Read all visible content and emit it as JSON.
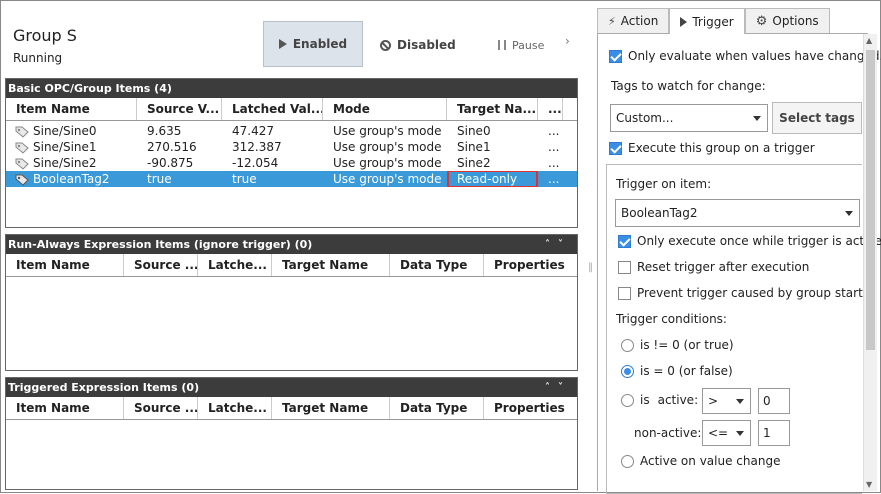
{
  "group": {
    "title": "Group S",
    "status": "Running"
  },
  "toolbar": {
    "enabled": "Enabled",
    "disabled": "Disabled",
    "pause": "Pause"
  },
  "basic_panel": {
    "title": "Basic OPC/Group Items (4)",
    "columns": [
      "Item Name",
      "Source V...",
      "Latched Val...",
      "Mode",
      "Target Na...",
      "..."
    ],
    "rows": [
      {
        "name": "Sine/Sine0",
        "source": "9.635",
        "latched": "47.427",
        "mode": "Use group's mode",
        "target": "Sine0",
        "props": "..."
      },
      {
        "name": "Sine/Sine1",
        "source": "270.516",
        "latched": "312.387",
        "mode": "Use group's mode",
        "target": "Sine1",
        "props": "..."
      },
      {
        "name": "Sine/Sine2",
        "source": "-90.875",
        "latched": "-12.054",
        "mode": "Use group's mode",
        "target": "Sine2",
        "props": "..."
      },
      {
        "name": "BooleanTag2",
        "source": "true",
        "latched": "true",
        "mode": "Use group's mode",
        "target": "Read-only",
        "props": "..."
      }
    ]
  },
  "run_always_panel": {
    "title": "Run-Always Expression Items (ignore trigger) (0)",
    "columns": [
      "Item Name",
      "Source ...",
      "Latche...",
      "Target Name",
      "Data Type",
      "Properties"
    ]
  },
  "triggered_panel": {
    "title": "Triggered Expression Items (0)",
    "columns": [
      "Item Name",
      "Source ...",
      "Latche...",
      "Target Name",
      "Data Type",
      "Properties"
    ]
  },
  "tabs": {
    "action": "Action",
    "trigger": "Trigger",
    "options": "Options"
  },
  "trigger_tab": {
    "only_evaluate": "Only evaluate when values have changed.",
    "tags_to_watch": "Tags to watch for change:",
    "tags_dropdown": "Custom...",
    "select_tags": "Select tags",
    "execute_on_trigger": "Execute this group on a trigger",
    "trigger_on_item": "Trigger on item:",
    "trigger_item_value": "BooleanTag2",
    "only_once": "Only execute once while trigger is active",
    "reset_trigger": "Reset trigger after execution",
    "prevent_trigger": "Prevent trigger caused by group start",
    "conditions_label": "Trigger conditions:",
    "cond_nonzero": "is != 0 (or true)",
    "cond_zero": "is = 0 (or false)",
    "cond_is": "is",
    "active_label": "active:",
    "active_op": ">",
    "active_value": "0",
    "nonactive_label": "non-active:",
    "nonactive_op": "<=",
    "nonactive_value": "1",
    "active_on_change": "Active on value change"
  },
  "colors": {
    "selection": "#3a9ad9",
    "panel_header": "#3c3c3c",
    "checkbox": "#3a8ee6",
    "highlight_border": "#e03030"
  }
}
